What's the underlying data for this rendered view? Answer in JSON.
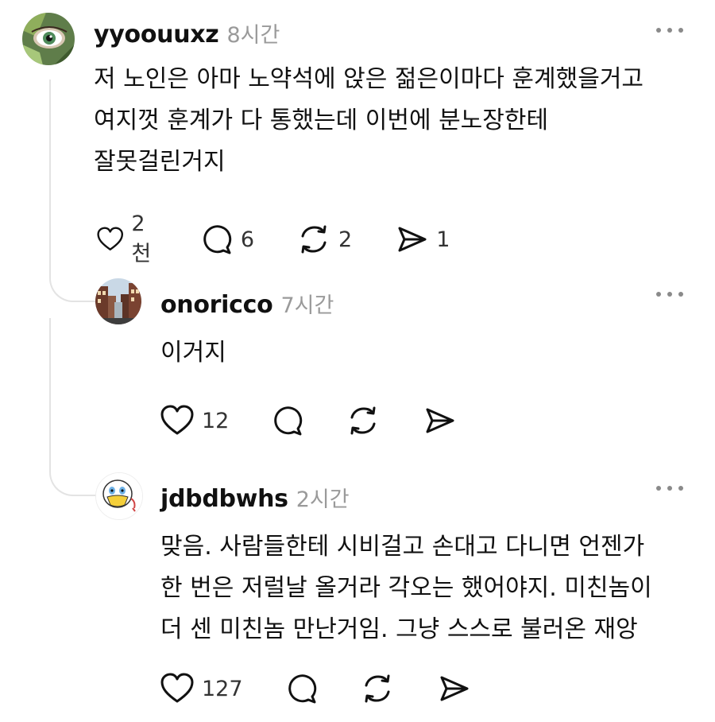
{
  "comments": [
    {
      "username": "yyoouuxz",
      "time": "8시간",
      "lines": [
        "저 노인은 아마 노약석에 앉은 젊은이마다 훈계했을거고",
        "여지껏 훈계가 다 통했는데 이번에 분노장한테",
        "잘못걸린거지"
      ],
      "likes": "2천",
      "replies": "6",
      "reposts": "2",
      "shares": "1"
    },
    {
      "username": "onoricco",
      "time": "7시간",
      "lines": [
        "이거지"
      ],
      "likes": "12",
      "replies": "",
      "reposts": "",
      "shares": ""
    },
    {
      "username": "jdbdbwhs",
      "time": "2시간",
      "lines": [
        "맞음. 사람들한테 시비걸고 손대고 다니면 언젠가",
        "한 번은 저럴날 올거라 각오는 했어야지. 미친놈이",
        "더 센 미친놈 만난거임. 그냥 스스로 불러온 재앙"
      ],
      "likes": "127",
      "replies": "",
      "reposts": "",
      "shares": ""
    }
  ],
  "icons": {
    "like": "heart-icon",
    "reply": "comment-icon",
    "repost": "repost-icon",
    "share": "send-icon",
    "more": "more-dots-icon"
  },
  "colors": {
    "text": "#111111",
    "muted": "#9a9a9a",
    "thread_line": "#e3e3e3"
  }
}
